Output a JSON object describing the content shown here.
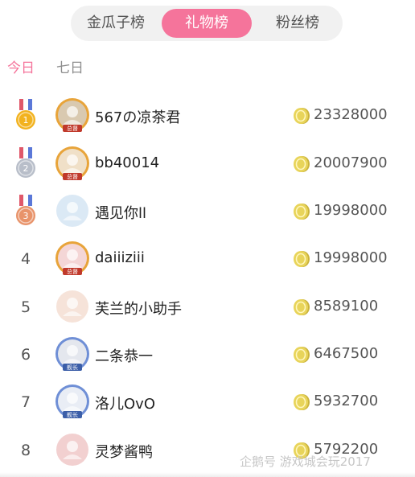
{
  "tabs": [
    {
      "label": "金瓜子榜",
      "active": false
    },
    {
      "label": "礼物榜",
      "active": true
    },
    {
      "label": "粉丝榜",
      "active": false
    }
  ],
  "periods": [
    {
      "label": "今日",
      "active": true
    },
    {
      "label": "七日",
      "active": false
    }
  ],
  "ranking": [
    {
      "rank": "1",
      "name": "567の凉茶君",
      "amount": "23328000",
      "medal": "gold",
      "badge": "总督"
    },
    {
      "rank": "2",
      "name": "bb40014",
      "amount": "20007900",
      "medal": "silver",
      "badge": "总督"
    },
    {
      "rank": "3",
      "name": "遇见你ll",
      "amount": "19998000",
      "medal": "bronze",
      "badge": ""
    },
    {
      "rank": "4",
      "name": "daiiiziii",
      "amount": "19998000",
      "medal": "",
      "badge": "总督"
    },
    {
      "rank": "5",
      "name": "芙兰的小助手",
      "amount": "8589100",
      "medal": "",
      "badge": ""
    },
    {
      "rank": "6",
      "name": "二条恭一",
      "amount": "6467500",
      "medal": "",
      "badge": "舰长"
    },
    {
      "rank": "7",
      "name": "洛儿OvO",
      "amount": "5932700",
      "medal": "",
      "badge": "舰长"
    },
    {
      "rank": "8",
      "name": "灵梦酱鸭",
      "amount": "5792200",
      "medal": "",
      "badge": ""
    }
  ],
  "watermark": "企鹅号 游戏城会玩2017",
  "colors": {
    "accent": "#f5749b",
    "coin": "#e8d45a",
    "gold": "#f2b21e",
    "silver": "#b8bec9",
    "bronze": "#e8936a"
  },
  "icons": {
    "coin": "gold-coin-icon",
    "medal": "medal-icon"
  }
}
